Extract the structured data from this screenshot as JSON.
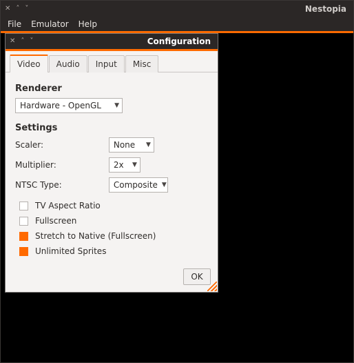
{
  "main": {
    "title": "Nestopia",
    "menubar": [
      "File",
      "Emulator",
      "Help"
    ]
  },
  "cfg": {
    "title": "Configuration",
    "tabs": [
      "Video",
      "Audio",
      "Input",
      "Misc"
    ],
    "active_tab": 0,
    "renderer": {
      "heading": "Renderer",
      "value": "Hardware - OpenGL"
    },
    "settings": {
      "heading": "Settings",
      "scaler_label": "Scaler:",
      "scaler_value": "None",
      "multiplier_label": "Multiplier:",
      "multiplier_value": "2x",
      "ntsc_label": "NTSC Type:",
      "ntsc_value": "Composite"
    },
    "checks": [
      {
        "label": "TV Aspect Ratio",
        "checked": false
      },
      {
        "label": "Fullscreen",
        "checked": false
      },
      {
        "label": "Stretch to Native (Fullscreen)",
        "checked": true
      },
      {
        "label": "Unlimited Sprites",
        "checked": true
      }
    ],
    "ok_label": "OK"
  }
}
